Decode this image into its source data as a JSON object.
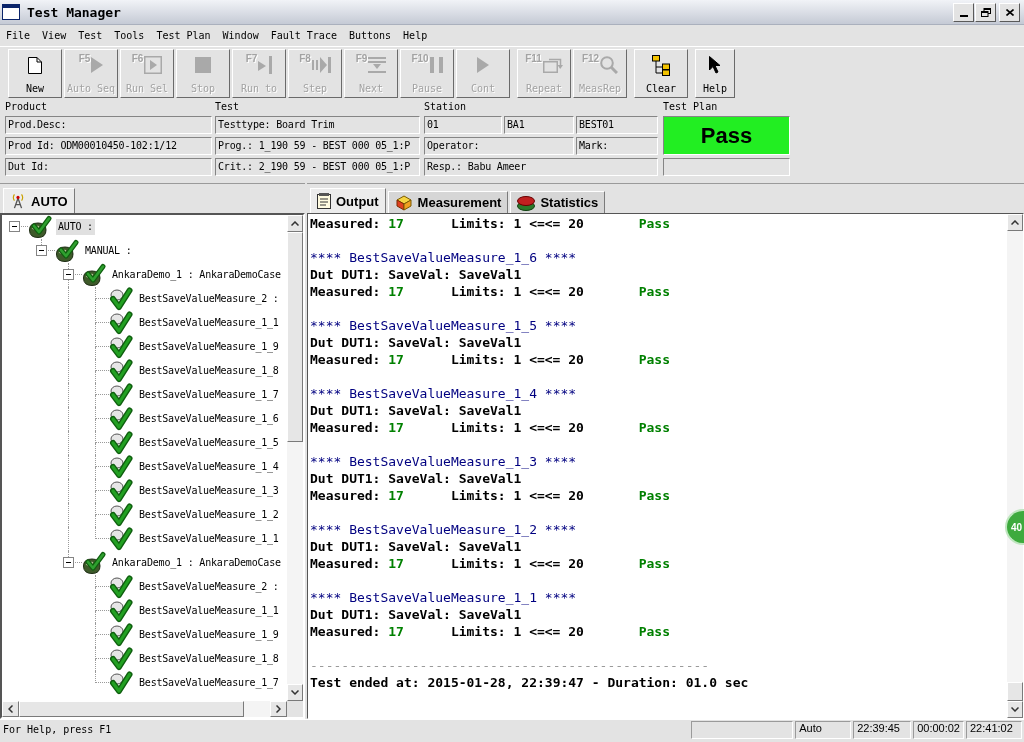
{
  "window": {
    "title": "Test Manager"
  },
  "menu": [
    "File",
    "View",
    "Test",
    "Tools",
    "Test Plan",
    "Window",
    "Fault Trace",
    "Buttons",
    "Help"
  ],
  "toolbar": {
    "groups": [
      [
        {
          "label": "New",
          "disabled": false
        },
        {
          "key": "F5",
          "label": "Auto Seq",
          "disabled": true
        },
        {
          "key": "F6",
          "label": "Run Sel",
          "disabled": true
        },
        {
          "label": "Stop",
          "disabled": true
        },
        {
          "key": "F7",
          "label": "Run to",
          "disabled": true
        },
        {
          "key": "F8",
          "label": "Step",
          "disabled": true
        },
        {
          "key": "F9",
          "label": "Next",
          "disabled": true
        },
        {
          "key": "F10",
          "label": "Pause",
          "disabled": true
        },
        {
          "label": "Cont",
          "disabled": true
        }
      ],
      [
        {
          "key": "F11",
          "label": "Repeat",
          "disabled": true
        },
        {
          "key": "F12",
          "label": "MeasRep",
          "disabled": true
        }
      ],
      [
        {
          "label": "Clear",
          "disabled": false
        }
      ],
      [
        {
          "label": "Help",
          "disabled": false
        }
      ]
    ]
  },
  "info": {
    "product": {
      "label": "Product",
      "fields": [
        "Prod.Desc:",
        "Prod Id: ODM00010450-102:1/12",
        "Dut Id:"
      ]
    },
    "test": {
      "label": "Test",
      "fields": [
        "Testtype: Board Trim",
        "Prog.: 1_190 59 - BEST 000 05_1:P",
        "Crit.: 2_190 59 - BEST 000 05_1:P"
      ]
    },
    "station": {
      "label": "Station",
      "ids": [
        "01",
        "BA1",
        "BEST01"
      ],
      "operator": "Operator:",
      "mark": "Mark:",
      "responsible": "Resp.: Babu Ameer"
    },
    "test_plan": {
      "label": "Test Plan",
      "result": "Pass",
      "passed": true
    }
  },
  "tree": {
    "tabs": [
      {
        "label": "AUTO",
        "selected": true
      }
    ],
    "items": [
      {
        "label": "AUTO :",
        "selected": true,
        "expanded": true,
        "children": [
          {
            "label": "MANUAL :",
            "selected": false,
            "expanded": true,
            "children": [
              {
                "label": "AnkaraDemo_1 : AnkaraDemoCase",
                "selected": false,
                "expanded": true,
                "children": [
                  {
                    "label": "BestSaveValueMeasure_2 :",
                    "selected": false
                  },
                  {
                    "label": "BestSaveValueMeasure_1_1",
                    "selected": false
                  },
                  {
                    "label": "BestSaveValueMeasure_1_9",
                    "selected": false
                  },
                  {
                    "label": "BestSaveValueMeasure_1_8",
                    "selected": false
                  },
                  {
                    "label": "BestSaveValueMeasure_1_7",
                    "selected": false
                  },
                  {
                    "label": "BestSaveValueMeasure_1_6",
                    "selected": false
                  },
                  {
                    "label": "BestSaveValueMeasure_1_5",
                    "selected": false
                  },
                  {
                    "label": "BestSaveValueMeasure_1_4",
                    "selected": false
                  },
                  {
                    "label": "BestSaveValueMeasure_1_3",
                    "selected": false
                  },
                  {
                    "label": "BestSaveValueMeasure_1_2",
                    "selected": false
                  },
                  {
                    "label": "BestSaveValueMeasure_1_1",
                    "selected": false
                  }
                ]
              },
              {
                "label": "AnkaraDemo_1 : AnkaraDemoCase",
                "selected": false,
                "expanded": true,
                "children": [
                  {
                    "label": "BestSaveValueMeasure_2 :",
                    "selected": false
                  },
                  {
                    "label": "BestSaveValueMeasure_1_1",
                    "selected": false
                  },
                  {
                    "label": "BestSaveValueMeasure_1_9",
                    "selected": false
                  },
                  {
                    "label": "BestSaveValueMeasure_1_8",
                    "selected": false
                  },
                  {
                    "label": "BestSaveValueMeasure_1_7",
                    "selected": false
                  }
                ]
              }
            ]
          }
        ]
      }
    ]
  },
  "output": {
    "tabs": [
      {
        "label": "Output",
        "selected": true
      },
      {
        "label": "Measurement",
        "selected": false
      },
      {
        "label": "Statistics",
        "selected": false
      }
    ],
    "lines": [
      {
        "kind": "measured",
        "label": "Measured:",
        "value": "17",
        "limits": "Limits: 1 <=<= 20",
        "result": "Pass",
        "passed": true
      },
      {
        "kind": "header",
        "text": "**** BestSaveValueMeasure_1_6 ****"
      },
      {
        "kind": "dut",
        "text": "Dut DUT1: SaveVal: SaveVal1"
      },
      {
        "kind": "measured",
        "label": "Measured:",
        "value": "17",
        "limits": "Limits: 1 <=<= 20",
        "result": "Pass",
        "passed": true
      },
      {
        "kind": "header",
        "text": "**** BestSaveValueMeasure_1_5 ****"
      },
      {
        "kind": "dut",
        "text": "Dut DUT1: SaveVal: SaveVal1"
      },
      {
        "kind": "measured",
        "label": "Measured:",
        "value": "17",
        "limits": "Limits: 1 <=<= 20",
        "result": "Pass",
        "passed": true
      },
      {
        "kind": "header",
        "text": "**** BestSaveValueMeasure_1_4 ****"
      },
      {
        "kind": "dut",
        "text": "Dut DUT1: SaveVal: SaveVal1"
      },
      {
        "kind": "measured",
        "label": "Measured:",
        "value": "17",
        "limits": "Limits: 1 <=<= 20",
        "result": "Pass",
        "passed": true
      },
      {
        "kind": "header",
        "text": "**** BestSaveValueMeasure_1_3 ****"
      },
      {
        "kind": "dut",
        "text": "Dut DUT1: SaveVal: SaveVal1"
      },
      {
        "kind": "measured",
        "label": "Measured:",
        "value": "17",
        "limits": "Limits: 1 <=<= 20",
        "result": "Pass",
        "passed": true
      },
      {
        "kind": "header",
        "text": "**** BestSaveValueMeasure_1_2 ****"
      },
      {
        "kind": "dut",
        "text": "Dut DUT1: SaveVal: SaveVal1"
      },
      {
        "kind": "measured",
        "label": "Measured:",
        "value": "17",
        "limits": "Limits: 1 <=<= 20",
        "result": "Pass",
        "passed": true
      },
      {
        "kind": "header",
        "text": "**** BestSaveValueMeasure_1_1 ****"
      },
      {
        "kind": "dut",
        "text": "Dut DUT1: SaveVal: SaveVal1"
      },
      {
        "kind": "measured",
        "label": "Measured:",
        "value": "17",
        "limits": "Limits: 1 <=<= 20",
        "result": "Pass",
        "passed": true
      },
      {
        "kind": "rule",
        "text": "---------------------------------------------------"
      },
      {
        "kind": "summary",
        "text": "Test ended at: 2015-01-28, 22:39:47 - Duration: 01.0 sec"
      }
    ]
  },
  "status_bar": {
    "help": "For Help, press F1",
    "panes": [
      "Auto",
      "22:39:45",
      "00:00:02",
      "22:41:02"
    ]
  },
  "floating_ball": {
    "text": "40"
  }
}
